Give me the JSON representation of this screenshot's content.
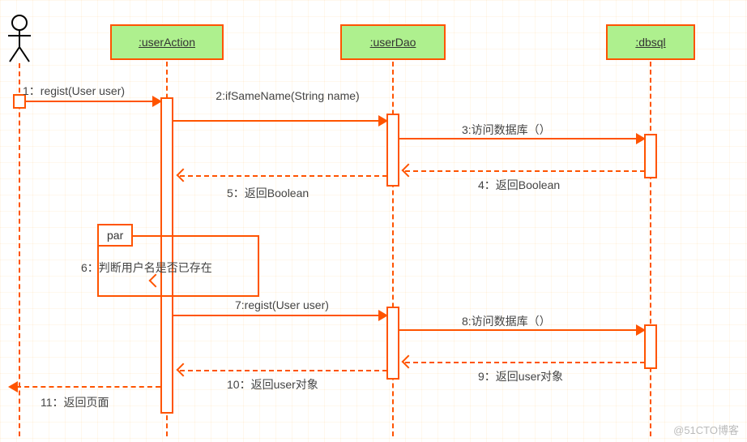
{
  "diagram_type": "UML sequence diagram",
  "actor": {
    "name": "Actor"
  },
  "lifelines": {
    "userAction": {
      "label": ":userAction"
    },
    "userDao": {
      "label": ":userDao"
    },
    "dbsql": {
      "label": ":dbsql"
    }
  },
  "fragment": {
    "kind": "par",
    "tag": "par",
    "guard_label": "6：判断用户名是否已存在"
  },
  "messages": {
    "m1": {
      "label": "1：regist(User user)",
      "from": "actor",
      "to": "userAction",
      "kind": "sync"
    },
    "m2": {
      "label": "2:ifSameName(String name)",
      "from": "userAction",
      "to": "userDao",
      "kind": "sync"
    },
    "m3": {
      "label": "3:访问数据库（）",
      "from": "userDao",
      "to": "dbsql",
      "kind": "sync"
    },
    "m4": {
      "label": "4：返回Boolean",
      "from": "dbsql",
      "to": "userDao",
      "kind": "return"
    },
    "m5": {
      "label": "5：返回Boolean",
      "from": "userDao",
      "to": "userAction",
      "kind": "return"
    },
    "m7": {
      "label": "7:regist(User user)",
      "from": "userAction",
      "to": "userDao",
      "kind": "sync"
    },
    "m8": {
      "label": "8:访问数据库（）",
      "from": "userDao",
      "to": "dbsql",
      "kind": "sync"
    },
    "m9": {
      "label": "9：返回user对象",
      "from": "dbsql",
      "to": "userDao",
      "kind": "return"
    },
    "m10": {
      "label": "10：返回user对象",
      "from": "userDao",
      "to": "userAction",
      "kind": "return"
    },
    "m11": {
      "label": "11：返回页面",
      "from": "userAction",
      "to": "actor",
      "kind": "return"
    }
  },
  "watermark": "@51CTO博客",
  "chart_data": {
    "type": "sequence-diagram",
    "participants": [
      "Actor",
      ":userAction",
      ":userDao",
      ":dbsql"
    ],
    "fragments": [
      {
        "type": "par",
        "label": "par",
        "note": "6：判断用户名是否已存在",
        "covers": [
          "userAction"
        ]
      }
    ],
    "interactions": [
      {
        "seq": 1,
        "from": "Actor",
        "to": ":userAction",
        "label": "regist(User user)",
        "style": "sync"
      },
      {
        "seq": 2,
        "from": ":userAction",
        "to": ":userDao",
        "label": "ifSameName(String name)",
        "style": "sync"
      },
      {
        "seq": 3,
        "from": ":userDao",
        "to": ":dbsql",
        "label": "访问数据库（）",
        "style": "sync"
      },
      {
        "seq": 4,
        "from": ":dbsql",
        "to": ":userDao",
        "label": "返回Boolean",
        "style": "return"
      },
      {
        "seq": 5,
        "from": ":userDao",
        "to": ":userAction",
        "label": "返回Boolean",
        "style": "return"
      },
      {
        "seq": 6,
        "from": ":userAction",
        "to": ":userAction",
        "label": "判断用户名是否已存在",
        "style": "self"
      },
      {
        "seq": 7,
        "from": ":userAction",
        "to": ":userDao",
        "label": "regist(User user)",
        "style": "sync"
      },
      {
        "seq": 8,
        "from": ":userDao",
        "to": ":dbsql",
        "label": "访问数据库（）",
        "style": "sync"
      },
      {
        "seq": 9,
        "from": ":dbsql",
        "to": ":userDao",
        "label": "返回user对象",
        "style": "return"
      },
      {
        "seq": 10,
        "from": ":userDao",
        "to": ":userAction",
        "label": "返回user对象",
        "style": "return"
      },
      {
        "seq": 11,
        "from": ":userAction",
        "to": "Actor",
        "label": "返回页面",
        "style": "return"
      }
    ]
  }
}
